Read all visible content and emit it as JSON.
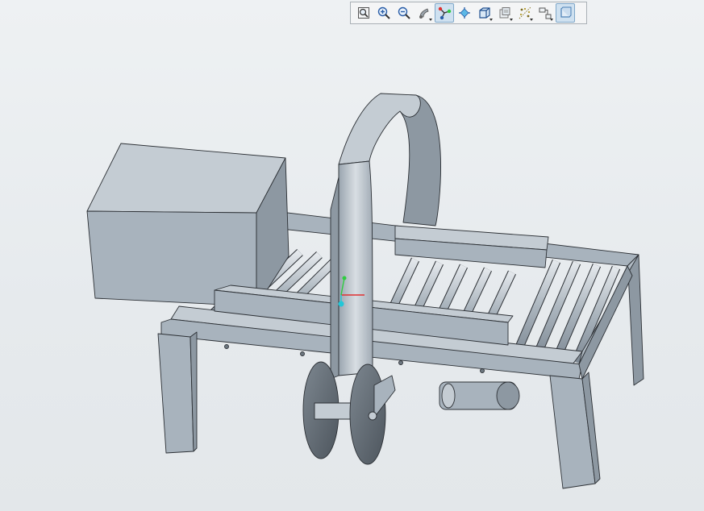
{
  "toolbar": {
    "buttons": [
      {
        "icon": "refit-icon",
        "active": false,
        "dropdown": false
      },
      {
        "icon": "zoom-in-icon",
        "active": false,
        "dropdown": false
      },
      {
        "icon": "zoom-out-icon",
        "active": false,
        "dropdown": false
      },
      {
        "icon": "repaint-icon",
        "active": false,
        "dropdown": true
      },
      {
        "icon": "datum-display-icon",
        "active": true,
        "dropdown": false
      },
      {
        "icon": "spin-center-icon",
        "active": false,
        "dropdown": false
      },
      {
        "icon": "view-orientation-icon",
        "active": false,
        "dropdown": true
      },
      {
        "icon": "saved-views-icon",
        "active": false,
        "dropdown": true
      },
      {
        "icon": "section-icon",
        "active": false,
        "dropdown": true
      },
      {
        "icon": "annotation-display-icon",
        "active": false,
        "dropdown": true
      },
      {
        "icon": "display-style-icon",
        "active": false,
        "dropdown": false
      }
    ]
  },
  "colors": {
    "background": "#e9ecee",
    "model_face": "#a8b3bd",
    "model_top": "#c4ccd3",
    "model_side": "#8d98a2",
    "edge": "#2c3035",
    "axis_x": "#e03030",
    "axis_y": "#2ecc40",
    "axis_z": "#22c7d8"
  }
}
